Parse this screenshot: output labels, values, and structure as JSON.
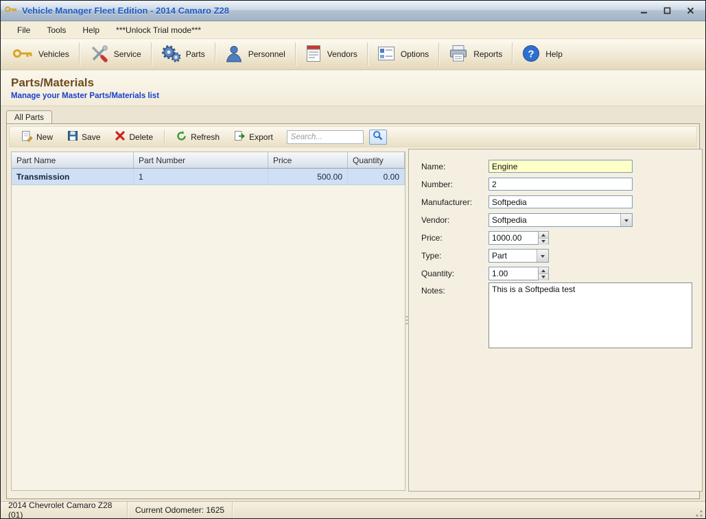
{
  "window": {
    "title": "Vehicle Manager Fleet Edition - 2014 Camaro Z28"
  },
  "menu": {
    "file": "File",
    "tools": "Tools",
    "help": "Help",
    "trial": "***Unlock Trial mode***"
  },
  "nav": {
    "vehicles": "Vehicles",
    "service": "Service",
    "parts": "Parts",
    "personnel": "Personnel",
    "vendors": "Vendors",
    "options": "Options",
    "reports": "Reports",
    "help": "Help"
  },
  "page": {
    "title": "Parts/Materials",
    "subtitle": "Manage your Master Parts/Materials list"
  },
  "tabs": {
    "all_parts": "All Parts"
  },
  "toolbar": {
    "new": "New",
    "save": "Save",
    "delete": "Delete",
    "refresh": "Refresh",
    "export": "Export",
    "search_placeholder": "Search..."
  },
  "table": {
    "columns": {
      "part_name": "Part Name",
      "part_number": "Part Number",
      "price": "Price",
      "quantity": "Quantity"
    },
    "rows": [
      {
        "part_name": "Transmission",
        "part_number": "1",
        "price": "500.00",
        "quantity": "0.00"
      }
    ]
  },
  "form": {
    "name": {
      "label": "Name:",
      "value": "Engine"
    },
    "number": {
      "label": "Number:",
      "value": "2"
    },
    "manufacturer": {
      "label": "Manufacturer:",
      "value": "Softpedia"
    },
    "vendor": {
      "label": "Vendor:",
      "value": "Softpedia"
    },
    "price": {
      "label": "Price:",
      "value": "1000.00"
    },
    "type": {
      "label": "Type:",
      "value": "Part"
    },
    "quantity": {
      "label": "Quantity:",
      "value": "1.00"
    },
    "notes": {
      "label": "Notes:",
      "value": "This is a Softpedia test"
    }
  },
  "statusbar": {
    "vehicle": "2014 Chevrolet Camaro Z28 (01)",
    "odometer": "Current Odometer: 1625"
  },
  "colors": {
    "title_text": "#1f5bc4",
    "heading": "#6e4a1f",
    "subtitle": "#1a3fcc",
    "selected_row": "#cfe0f5",
    "highlight_field": "#ffffc8"
  }
}
